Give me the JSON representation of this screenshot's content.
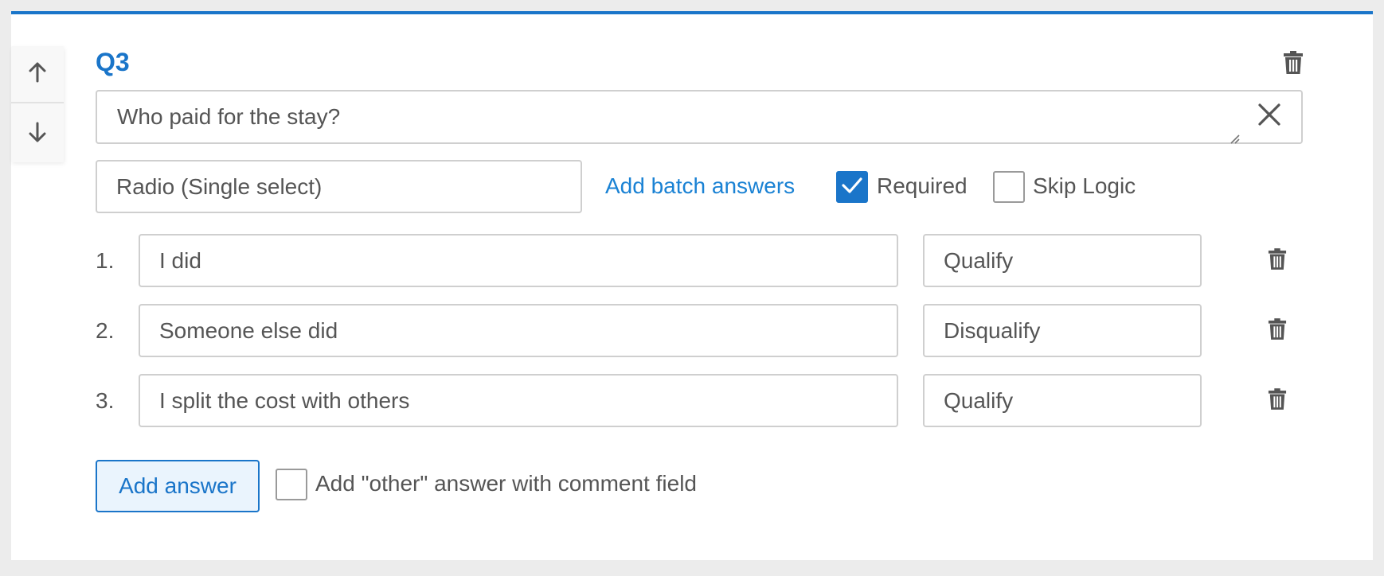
{
  "question": {
    "label": "Q3",
    "text": "Who paid for the stay?",
    "type": "Radio (Single select)",
    "batch_link": "Add batch answers",
    "required_label": "Required",
    "required_checked": true,
    "skip_logic_label": "Skip Logic",
    "skip_logic_checked": false
  },
  "answers": [
    {
      "number": "1.",
      "text": "I did",
      "action": "Qualify"
    },
    {
      "number": "2.",
      "text": "Someone else did",
      "action": "Disqualify"
    },
    {
      "number": "3.",
      "text": "I split the cost with others",
      "action": "Qualify"
    }
  ],
  "footer": {
    "add_answer": "Add answer",
    "other_label": "Add \"other\" answer with comment field",
    "other_checked": false
  },
  "icons": {
    "move_up": "arrow-up-icon",
    "move_down": "arrow-down-icon",
    "delete": "trash-icon",
    "clear": "close-icon",
    "check": "checkmark-icon"
  },
  "colors": {
    "accent": "#1a75c9",
    "link": "#1a82d4",
    "add_button_bg": "#eaf4fd",
    "background": "#ececec"
  }
}
